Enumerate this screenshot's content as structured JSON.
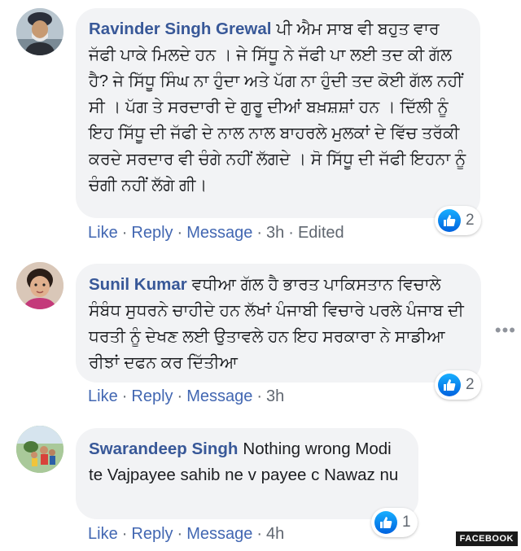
{
  "comments": [
    {
      "author": "Ravinder Singh Grewal",
      "text": "ਪੀ ਐਮ ਸਾਬ ਵੀ ਬਹੁਤ ਵਾਰ ਜੱਫੀ ਪਾਕੇ ਮਿਲਦੇ ਹਨ । ਜੇ ਸਿੱਧੂ ਨੇ ਜੱਫੀ ਪਾ ਲਈ ਤਦ ਕੀ ਗੱਲ ਹੈ? ਜੇ ਸਿੱਧੂ ਸਿੰਘ ਨਾ ਹੁੰਦਾ ਅਤੇ ਪੱਗ ਨਾ ਹੁੰਦੀ ਤਦ ਕੋਈ ਗੱਲ ਨਹੀਂ ਸੀ । ਪੱਗ ਤੇ ਸਰਦਾਰੀ ਦੇ ਗੁਰੂ ਦੀਆਂ ਬਖ਼ਸ਼ਸ਼ਾਂ ਹਨ । ਦਿੱਲੀ ਨੂੰ ਇਹ ਸਿੱਧੂ ਦੀ ਜੱਫੀ ਦੇ ਨਾਲ ਨਾਲ ਬਾਹਰਲੇ ਮੁਲਕਾਂ ਦੇ ਵਿੱਚ ਤਰੱਕੀ ਕਰਦੇ ਸਰਦਾਰ ਵੀ ਚੰਗੇ ਨਹੀਂ ਲੱਗਦੇ । ਸੋ ਸਿੱਧੂ ਦੀ ਜੱਫੀ ਇਹਨਾ ਨੂੰ ਚੰਗੀ ਨਹੀਂ ਲੱਗੇ ਗੀ।",
      "like": "Like",
      "reply": "Reply",
      "message": "Message",
      "time": "3h",
      "edited": "Edited",
      "reactions": "2"
    },
    {
      "author": "Sunil Kumar",
      "text": "ਵਧੀਆ ਗੱਲ ਹੈ ਭਾਰਤ ਪਾਕਿਸਤਾਨ ਵਿਚਾਲੇ ਸੰਬੰਧ ਸੁਧਰਨੇ ਚਾਹੀਦੇ ਹਨ ਲੱਖਾਂ ਪੰਜਾਬੀ ਵਿਚਾਰੇ ਪਰਲੇ ਪੰਜਾਬ ਦੀ ਧਰਤੀ ਨੂੰ ਦੇਖਣ ਲਈ ਉਤਾਵਲੇ ਹਨ ਇਹ ਸਰਕਾਰਾ ਨੇ ਸਾਡੀਆ ਰੀਝਾਂ ਦਫਨ ਕਰ ਦਿੱਤੀਆ",
      "like": "Like",
      "reply": "Reply",
      "message": "Message",
      "time": "3h",
      "reactions": "2"
    },
    {
      "author": "Swarandeep Singh",
      "text": "Nothing wrong Modi te Vajpayee sahib ne v payee c Nawaz nu",
      "like": "Like",
      "reply": "Reply",
      "message": "Message",
      "time": "4h",
      "reactions": "1"
    }
  ],
  "more_options": "•••",
  "watermark": "FACEBOOK",
  "colors": {
    "author": "#385898",
    "link": "#4267b2",
    "bubble": "#f2f3f5",
    "like_blue": "#1877f2"
  }
}
